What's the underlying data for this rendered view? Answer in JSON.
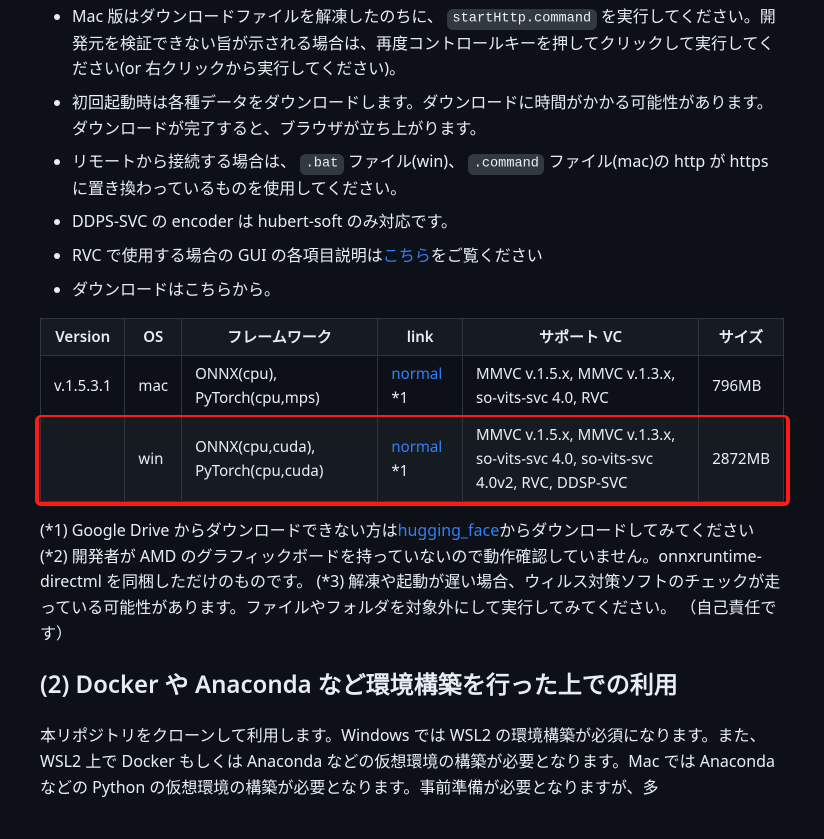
{
  "bullets": {
    "b0_before_code": "Mac 版はダウンロードファイルを解凍したのちに、",
    "b0_code": "startHttp.command",
    "b0_after_code": "を実行してください。開発元を検証できない旨が示される場合は、再度コントロールキーを押してクリックして実行してください(or 右クリックから実行してください)。",
    "b1": "初回起動時は各種データをダウンロードします。ダウンロードに時間がかかる可能性があります。ダウンロードが完了すると、ブラウザが立ち上がります。",
    "b2_before": "リモートから接続する場合は、",
    "b2_code1": ".bat",
    "b2_mid1": " ファイル(win)、",
    "b2_code2": ".command",
    "b2_after": " ファイル(mac)の http が https に置き換わっているものを使用してください。",
    "b3": "DDPS-SVC の encoder は hubert-soft のみ対応です。",
    "b4_before": "RVC で使用する場合の GUI の各項目説明は",
    "b4_link": "こちら",
    "b4_after": "をご覧ください",
    "b5": "ダウンロードはこちらから。"
  },
  "table": {
    "headers": {
      "version": "Version",
      "os": "OS",
      "framework": "フレームワーク",
      "link": "link",
      "support": "サポート VC",
      "size": "サイズ"
    },
    "rows": [
      {
        "version": "v.1.5.3.1",
        "os": "mac",
        "framework": "ONNX(cpu), PyTorch(cpu,mps)",
        "link_text": "normal",
        "link_suffix": " *1",
        "support": "MMVC v.1.5.x, MMVC v.1.3.x, so-vits-svc 4.0, RVC",
        "size": "796MB"
      },
      {
        "version": "",
        "os": "win",
        "framework": "ONNX(cpu,cuda), PyTorch(cpu,cuda)",
        "link_text": "normal",
        "link_suffix": " *1",
        "support": "MMVC v.1.5.x, MMVC v.1.3.x, so-vits-svc 4.0, so-vits-svc 4.0v2, RVC, DDSP-SVC",
        "size": "2872MB"
      }
    ]
  },
  "notes": {
    "n1_before": "(*1) Google Drive からダウンロードできない方は",
    "n1_link": "hugging_face",
    "n1_after": "からダウンロードしてみてください (*2) 開発者が AMD のグラフィックボードを持っていないので動作確認していません。onnxruntime-directml を同梱しただけのものです。 (*3) 解凍や起動が遅い場合、ウィルス対策ソフトのチェックが走っている可能性があります。ファイルやフォルダを対象外にして実行してみてください。 （自己責任です）"
  },
  "heading": "(2) Docker や Anaconda など環境構築を行った上での利用",
  "closing": "本リポジトリをクローンして利用します。Windows では WSL2 の環境構築が必須になります。また、WSL2 上で Docker もしくは Anaconda などの仮想環境の構築が必要となります。Mac では Anaconda などの Python の仮想環境の構築が必要となります。事前準備が必要となりますが、多"
}
